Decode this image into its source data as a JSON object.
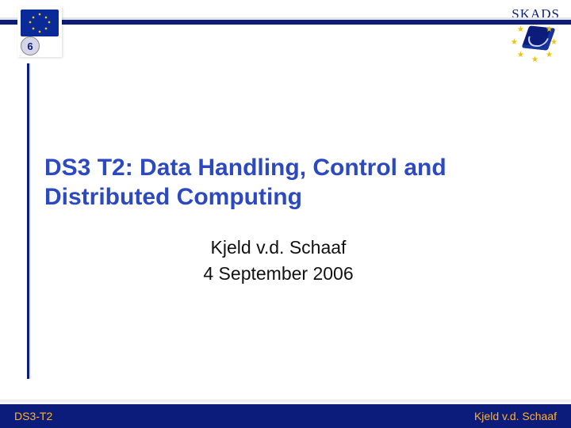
{
  "header": {
    "left_logo_alt": "EU FP6 emblem",
    "right_logo_text": "SKADS"
  },
  "title": "DS3 T2: Data Handling, Control and Distributed Computing",
  "meta": {
    "author": "Kjeld v.d. Schaaf",
    "date": "4 September 2006"
  },
  "footer": {
    "left": "DS3-T2",
    "right": "Kjeld v.d. Schaaf"
  }
}
